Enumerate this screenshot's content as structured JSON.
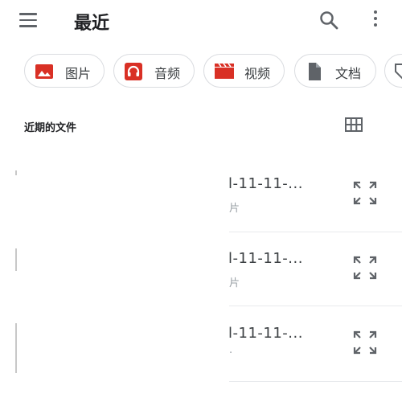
{
  "appbar": {
    "title": "最近",
    "icons": [
      "menu-icon",
      "search-icon",
      "more-vert-icon"
    ]
  },
  "chips": [
    {
      "label": "图片",
      "icon": "image-icon",
      "color": "#d93025"
    },
    {
      "label": "音频",
      "icon": "headphones-icon",
      "color": "#d93025"
    },
    {
      "label": "视频",
      "icon": "movie-icon",
      "color": "#d93025"
    },
    {
      "label": "文档",
      "icon": "document-icon",
      "color": "#5f6368"
    }
  ],
  "section": {
    "title": "近期的文件",
    "view_icon": "grid-view-icon"
  },
  "files": [
    {
      "name": "l-11-11-...",
      "sub": "片"
    },
    {
      "name": "l-11-11-...",
      "sub": "片"
    },
    {
      "name": "l-11-11-...",
      "sub": "·"
    }
  ],
  "colors": {
    "accent": "#d93025",
    "icon_gray": "#5f6368",
    "divider": "#e8eaed"
  }
}
